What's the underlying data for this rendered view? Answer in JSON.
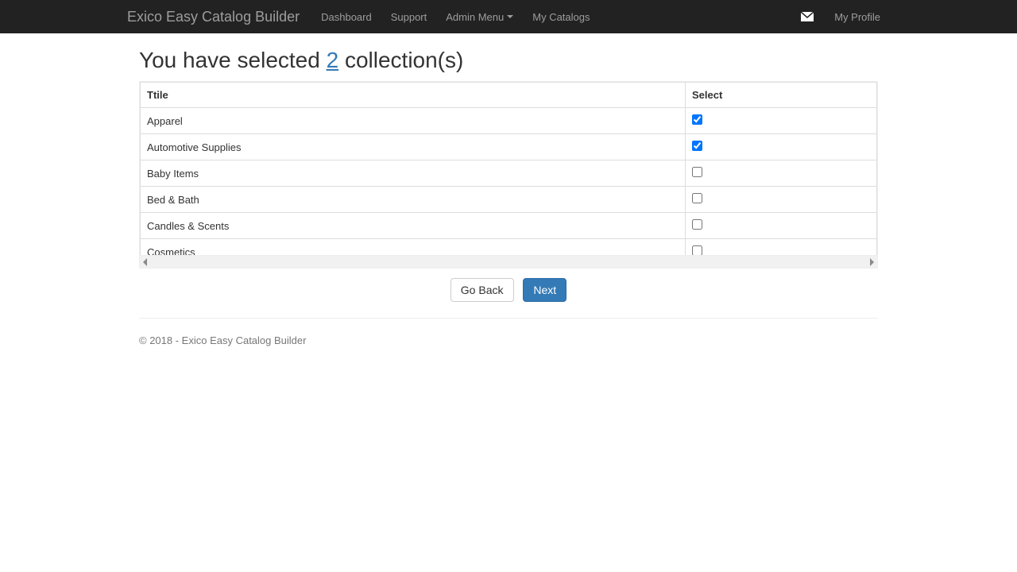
{
  "navbar": {
    "brand": "Exico Easy Catalog Builder",
    "items": [
      {
        "label": "Dashboard",
        "dropdown": false
      },
      {
        "label": "Support",
        "dropdown": false
      },
      {
        "label": "Admin Menu",
        "dropdown": true
      },
      {
        "label": "My Catalogs",
        "dropdown": false
      }
    ],
    "profile_label": "My Profile"
  },
  "main": {
    "heading_prefix": "You have selected ",
    "heading_count": "2",
    "heading_suffix": " collection(s)",
    "columns": {
      "title": "Ttile",
      "select": "Select"
    },
    "rows": [
      {
        "title": "Apparel",
        "checked": true
      },
      {
        "title": "Automotive Supplies",
        "checked": true
      },
      {
        "title": "Baby Items",
        "checked": false
      },
      {
        "title": "Bed & Bath",
        "checked": false
      },
      {
        "title": "Candles & Scents",
        "checked": false
      },
      {
        "title": "Cosmetics",
        "checked": false
      }
    ],
    "buttons": {
      "back": "Go Back",
      "next": "Next"
    }
  },
  "footer": {
    "text": "© 2018 - Exico Easy Catalog Builder"
  }
}
